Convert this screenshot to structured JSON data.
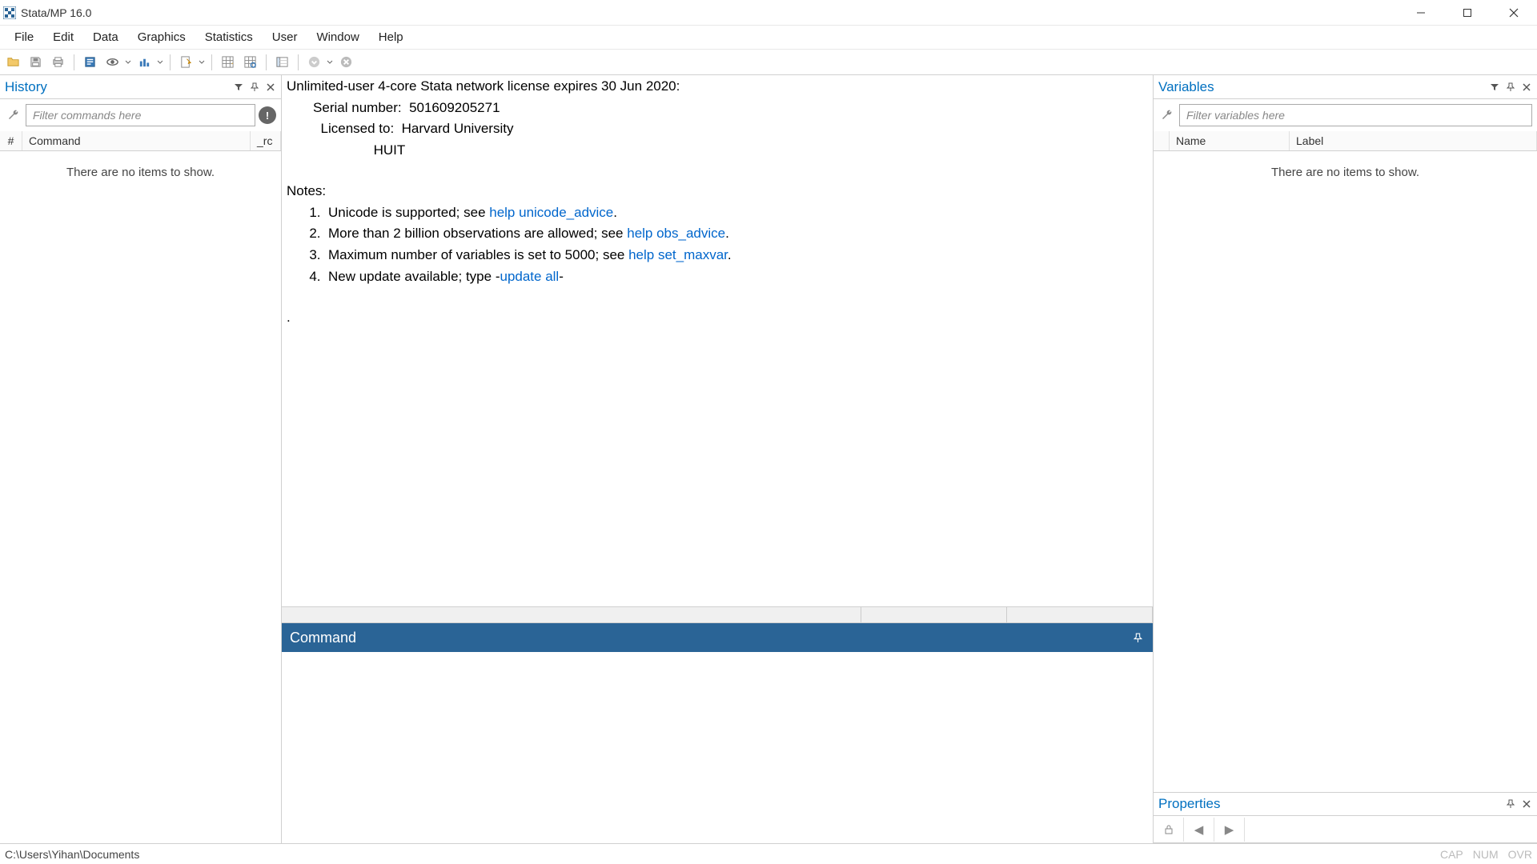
{
  "title_bar": {
    "title": "Stata/MP 16.0"
  },
  "menu": {
    "file": "File",
    "edit": "Edit",
    "data": "Data",
    "graphics": "Graphics",
    "statistics": "Statistics",
    "user": "User",
    "window": "Window",
    "help": "Help"
  },
  "history": {
    "title": "History",
    "filter_placeholder": "Filter commands here",
    "col_hash": "#",
    "col_command": "Command",
    "col_rc": "_rc",
    "empty": "There are no items to show."
  },
  "results": {
    "license_line": "Unlimited-user 4-core Stata network license expires 30 Jun 2020:",
    "serial_label": "       Serial number:  ",
    "serial_value": "501609205271",
    "licensed_label": "         Licensed to:  ",
    "licensed_value": "Harvard University",
    "licensed_to_2": "                       HUIT",
    "notes_label": "Notes:",
    "note1_pre": "      1.  Unicode is supported; see ",
    "note1_link": "help unicode_advice",
    "note1_post": ".",
    "note2_pre": "      2.  More than 2 billion observations are allowed; see ",
    "note2_link": "help obs_advice",
    "note2_post": ".",
    "note3_pre": "      3.  Maximum number of variables is set to 5000; see ",
    "note3_link": "help set_maxvar",
    "note3_post": ".",
    "note4_pre": "      4.  New update available; type -",
    "note4_link": "update all",
    "note4_post": "-",
    "prompt": "."
  },
  "command": {
    "title": "Command"
  },
  "variables": {
    "title": "Variables",
    "filter_placeholder": "Filter variables here",
    "col_name": "Name",
    "col_label": "Label",
    "empty": "There are no items to show."
  },
  "properties": {
    "title": "Properties"
  },
  "status": {
    "path": "C:\\Users\\Yihan\\Documents",
    "cap": "CAP",
    "num": "NUM",
    "ovr": "OVR"
  }
}
